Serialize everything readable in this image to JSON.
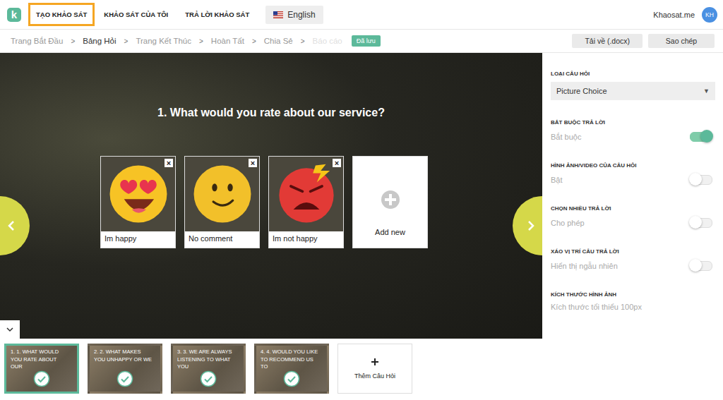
{
  "header": {
    "logo": "k",
    "nav": [
      {
        "label": "TẠO KHẢO SÁT",
        "selected": true
      },
      {
        "label": "KHẢO SÁT CỦA TÔI",
        "selected": false
      },
      {
        "label": "TRẢ LỜI KHẢO SÁT",
        "selected": false
      }
    ],
    "language": "English",
    "site": "Khaosat.me",
    "avatar": "KH"
  },
  "steps": [
    {
      "label": "Trang Bắt Đầu",
      "selected": false,
      "disabled": false
    },
    {
      "label": "Bảng Hỏi",
      "selected": true,
      "disabled": false
    },
    {
      "label": "Trang Kết Thúc",
      "selected": false,
      "disabled": false
    },
    {
      "label": "Hoàn Tất",
      "selected": false,
      "disabled": false
    },
    {
      "label": "Chia Sẻ",
      "selected": false,
      "disabled": false
    },
    {
      "label": "Báo cáo",
      "selected": false,
      "disabled": true
    }
  ],
  "step_separator": ">",
  "saved_badge": "Đã lưu",
  "actions": [
    "Tải về (.docx)",
    "Sao chép"
  ],
  "question": {
    "title": "1. What would you rate about our service?",
    "choices": [
      {
        "label": "Im happy",
        "kind": "love",
        "close": "×"
      },
      {
        "label": "No comment",
        "kind": "neutral",
        "close": "×"
      },
      {
        "label": "Im not happy",
        "kind": "angry",
        "close": "×"
      }
    ],
    "add_label": "Add new"
  },
  "settings": {
    "type_label": "LOẠI CÂU HỎI",
    "type_value": "Picture Choice",
    "dropdown_arrow": "▼",
    "toggles": [
      {
        "label": "BẮT BUỘC TRẢ LỜI",
        "value": "Bắt buộc",
        "on": true
      },
      {
        "label": "HÌNH ẢNH/VIDEO CỦA CÂU HỎI",
        "value": "Bật",
        "on": false
      },
      {
        "label": "CHỌN NHIỀU TRẢ LỜI",
        "value": "Cho phép",
        "on": false
      },
      {
        "label": "XÁO VỊ TRÍ CÂU TRẢ LỜI",
        "value": "Hiển thị ngẫu nhiên",
        "on": false
      }
    ],
    "size": {
      "label": "KÍCH THƯỚC HÌNH ẢNH",
      "value": "Kích thước tối thiểu 100px"
    }
  },
  "thumbnails": [
    {
      "text": "1. 1. WHAT WOULD YOU RATE ABOUT OUR",
      "selected": true
    },
    {
      "text": "2. 2. WHAT MAKES YOU UNHAPPY OR WE",
      "selected": false
    },
    {
      "text": "3. 3. WE ARE ALWAYS LISTENING TO WHAT YOU",
      "selected": false
    },
    {
      "text": "4. 4. WOULD YOU LIKE TO RECOMMEND US TO",
      "selected": false
    }
  ],
  "add_question": "Thêm Câu Hỏi"
}
